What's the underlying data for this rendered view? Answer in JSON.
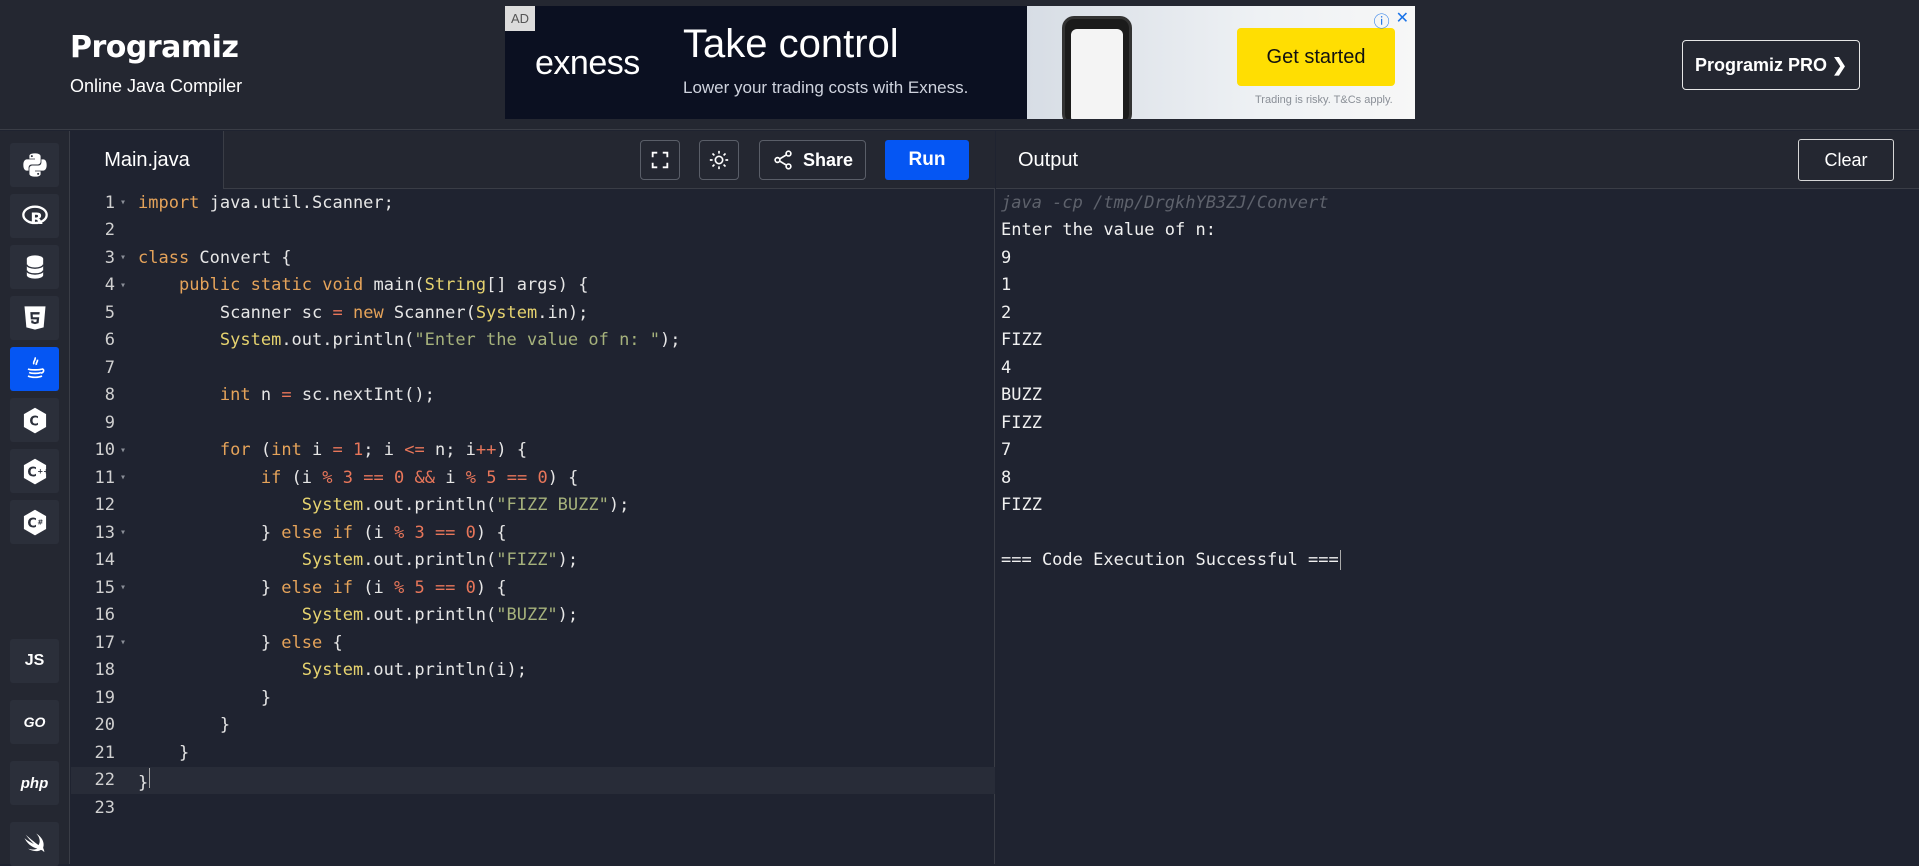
{
  "header": {
    "brand_name": "Programiz",
    "brand_subtitle": "Online Java Compiler",
    "pro_button": "Programiz PRO ❯"
  },
  "ad": {
    "tag": "AD",
    "brand": "exness",
    "title": "Take control",
    "subtitle": "Lower your trading costs with Exness.",
    "cta": "Get started",
    "disclaimer": "Trading is risky. T&Cs apply."
  },
  "sidebar": {
    "languages": [
      {
        "name": "python",
        "label": ""
      },
      {
        "name": "r",
        "label": ""
      },
      {
        "name": "sql",
        "label": ""
      },
      {
        "name": "html",
        "label": ""
      },
      {
        "name": "java",
        "label": "",
        "active": true
      },
      {
        "name": "c",
        "label": ""
      },
      {
        "name": "cpp",
        "label": ""
      },
      {
        "name": "csharp",
        "label": ""
      },
      {
        "name": "js",
        "label": "JS"
      },
      {
        "name": "go",
        "label": "GO"
      },
      {
        "name": "php",
        "label": "php"
      },
      {
        "name": "swift",
        "label": ""
      }
    ]
  },
  "editor": {
    "file_tab": "Main.java",
    "share_label": "Share",
    "run_label": "Run"
  },
  "output": {
    "title": "Output",
    "clear_label": "Clear",
    "lines": [
      "java -cp /tmp/DrgkhYB3ZJ/Convert",
      "Enter the value of n:",
      "9",
      "1",
      "2",
      "FIZZ",
      "4",
      "BUZZ",
      "FIZZ",
      "7",
      "8",
      "FIZZ",
      "",
      "=== Code Execution Successful ==="
    ]
  },
  "code": {
    "line_numbers": [
      "1",
      "2",
      "3",
      "4",
      "5",
      "6",
      "7",
      "8",
      "9",
      "10",
      "11",
      "12",
      "13",
      "14",
      "15",
      "16",
      "17",
      "18",
      "19",
      "20",
      "21",
      "22",
      "23"
    ]
  },
  "colors": {
    "accent": "#0556f3",
    "keyword": "#e5a35a",
    "type": "#e6d36f",
    "number": "#e8765a",
    "string": "#a6b27c"
  }
}
